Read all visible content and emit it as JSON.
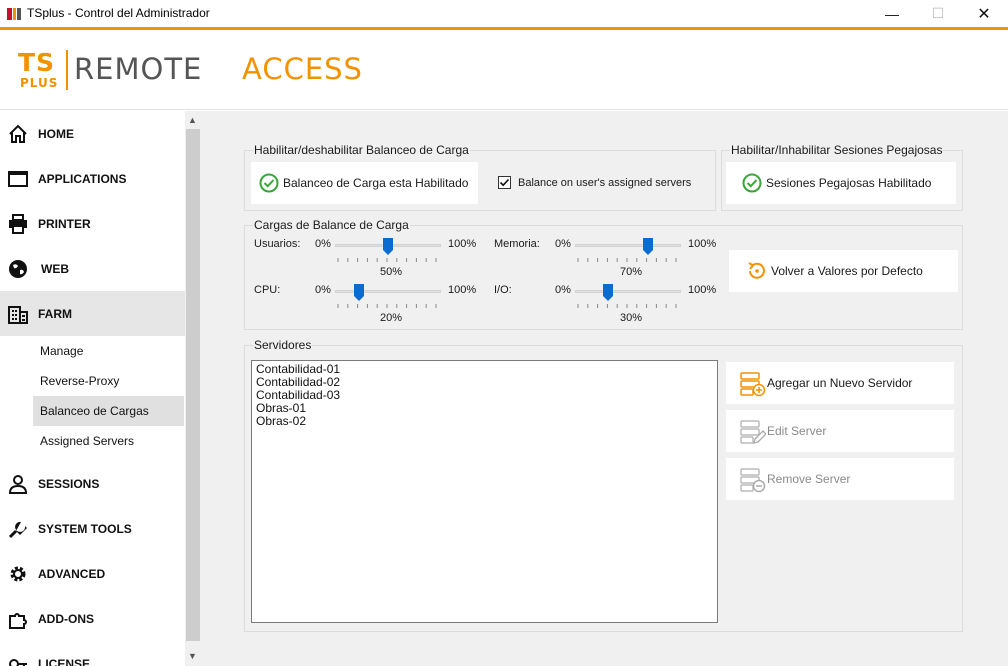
{
  "window": {
    "title": "TSplus - Control del Administrador",
    "minimize_glyph": "—",
    "maximize_glyph": "☐",
    "close_glyph": "✕"
  },
  "brand": {
    "ts": "TS",
    "plus": "PLUS",
    "remote": "REMOTE",
    "access": "ACCESS"
  },
  "colors": {
    "accent": "#f39200",
    "green": "#3aa63a",
    "slider_blue": "#0a6cd1"
  },
  "sidebar": {
    "items": [
      {
        "label": "HOME",
        "icon": "home-icon"
      },
      {
        "label": "APPLICATIONS",
        "icon": "window-icon"
      },
      {
        "label": "PRINTER",
        "icon": "printer-icon"
      },
      {
        "label": "WEB",
        "icon": "globe-icon"
      },
      {
        "label": "FARM",
        "icon": "building-icon",
        "active": true
      },
      {
        "label": "SESSIONS",
        "icon": "user-icon"
      },
      {
        "label": "SYSTEM TOOLS",
        "icon": "wrench-icon"
      },
      {
        "label": "ADVANCED",
        "icon": "gear-icon"
      },
      {
        "label": "ADD-ONS",
        "icon": "puzzle-icon"
      },
      {
        "label": "LICENSE",
        "icon": "key-icon"
      }
    ],
    "farm_subitems": [
      {
        "label": "Manage"
      },
      {
        "label": "Reverse-Proxy"
      },
      {
        "label": "Balanceo de Cargas",
        "active": true
      },
      {
        "label": "Assigned Servers"
      }
    ]
  },
  "load_balancing": {
    "group_title": "Habilitar/deshabilitar Balanceo de Carga",
    "enabled_label": "Balanceo de Carga esta Habilitado",
    "assigned_checkbox_label": "Balance on user's assigned servers",
    "assigned_checked": true
  },
  "sticky_sessions": {
    "group_title": "Habilitar/Inhabilitar Sesiones Pegajosas",
    "enabled_label": "Sesiones Pegajosas Habilitado"
  },
  "loads": {
    "group_title": "Cargas de Balance de Carga",
    "min_label": "0%",
    "max_label": "100%",
    "sliders": [
      {
        "label": "Usuarios:",
        "value": 50,
        "value_label": "50%"
      },
      {
        "label": "Memoria:",
        "value": 70,
        "value_label": "70%"
      },
      {
        "label": "CPU:",
        "value": 20,
        "value_label": "20%"
      },
      {
        "label": "I/O:",
        "value": 30,
        "value_label": "30%"
      }
    ],
    "reset_button": "Volver a Valores por Defecto"
  },
  "servers": {
    "group_title": "Servidores",
    "list": [
      "Contabilidad-01",
      "Contabilidad-02",
      "Contabilidad-03",
      "Obras-01",
      "Obras-02"
    ],
    "add_button": "Agregar un Nuevo Servidor",
    "edit_button": "Edit Server",
    "remove_button": "Remove Server"
  }
}
